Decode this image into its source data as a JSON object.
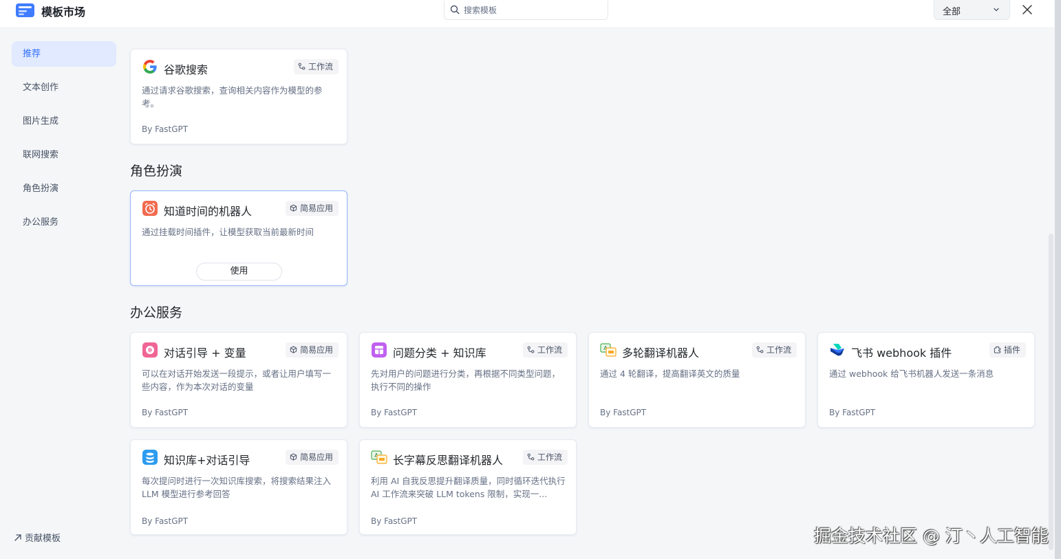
{
  "header": {
    "title": "模板市场",
    "search_placeholder": "搜索模板",
    "filter_value": "全部"
  },
  "sidebar": {
    "items": [
      {
        "label": "推荐",
        "active": true
      },
      {
        "label": "文本创作"
      },
      {
        "label": "图片生成"
      },
      {
        "label": "联网搜索"
      },
      {
        "label": "角色扮演"
      },
      {
        "label": "办公服务"
      }
    ],
    "contribute_label": "贡献模板"
  },
  "sections": [
    {
      "title": "角色扮演"
    },
    {
      "title": "办公服务"
    }
  ],
  "cards": [
    {
      "title": "谷歌搜索",
      "tag": "工作流",
      "icon": "google-icon",
      "desc": "通过请求谷歌搜索，查询相关内容作为模型的参考。",
      "author": "By FastGPT"
    },
    {
      "title": "知道时间的机器人",
      "tag": "简易应用",
      "icon": "alarm-clock-icon",
      "desc": "通过挂载时间插件，让模型获取当前最新时间",
      "button": "使用"
    },
    {
      "title": "对话引导 + 变量",
      "tag": "简易应用",
      "icon": "chat-guide-icon",
      "desc": "可以在对话开始发送一段提示，或者让用户填写一些内容，作为本次对话的变量",
      "author": "By FastGPT"
    },
    {
      "title": "问题分类 + 知识库",
      "tag": "工作流",
      "icon": "classify-icon",
      "desc": "先对用户的问题进行分类，再根据不同类型问题，执行不同的操作",
      "author": "By FastGPT"
    },
    {
      "title": "多轮翻译机器人",
      "tag": "工作流",
      "icon": "translate-icon",
      "desc": "通过 4 轮翻译，提高翻译英文的质量",
      "author": "By FastGPT"
    },
    {
      "title": "飞书 webhook 插件",
      "tag": "插件",
      "icon": "feishu-icon",
      "desc": "通过 webhook 给飞书机器人发送一条消息",
      "author": "By FastGPT"
    },
    {
      "title": "知识库+对话引导",
      "tag": "简易应用",
      "icon": "database-icon",
      "desc": "每次提问时进行一次知识库搜索，将搜索结果注入 LLM 模型进行参考回答",
      "author": "By FastGPT"
    },
    {
      "title": "长字幕反思翻译机器人",
      "tag": "工作流",
      "icon": "translate-icon",
      "desc": "利用 AI 自我反思提升翻译质量，同时循环迭代执行 AI 工作流来突破 LLM tokens 限制，实现一...",
      "author": "By FastGPT"
    }
  ],
  "watermark": "掘金技术社区 @ 汀丶人工智能"
}
